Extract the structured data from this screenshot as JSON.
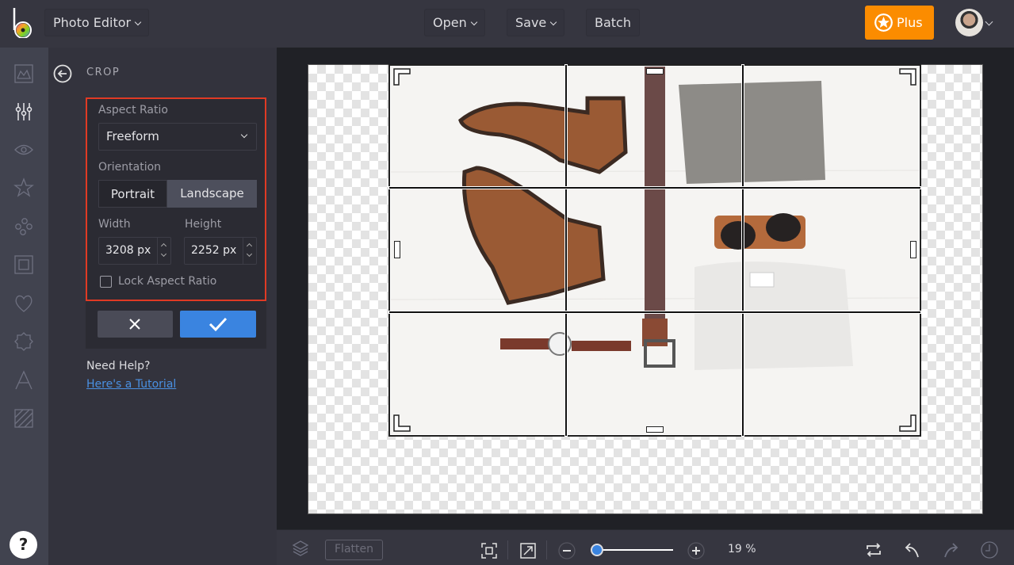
{
  "topbar": {
    "app_menu_label": "Photo Editor",
    "open_label": "Open",
    "save_label": "Save",
    "batch_label": "Batch",
    "plus_label": "Plus",
    "plus_color": "#fb8c00"
  },
  "rail": {
    "items": [
      {
        "name": "image-icon",
        "label": "Image"
      },
      {
        "name": "adjust-sliders-icon",
        "label": "Edit",
        "active": true
      },
      {
        "name": "eye-icon",
        "label": "Effects"
      },
      {
        "name": "star-icon",
        "label": "Touch Up"
      },
      {
        "name": "circles-icon",
        "label": "Artsy"
      },
      {
        "name": "frame-icon",
        "label": "Frames"
      },
      {
        "name": "heart-icon",
        "label": "Graphics"
      },
      {
        "name": "badge-icon",
        "label": "Overlays"
      },
      {
        "name": "text-icon",
        "label": "Text"
      },
      {
        "name": "texture-icon",
        "label": "Textures"
      }
    ],
    "help_label": "?"
  },
  "panel": {
    "title": "CROP",
    "aspect_ratio_label": "Aspect Ratio",
    "aspect_ratio_value": "Freeform",
    "orientation_label": "Orientation",
    "orientation_options": [
      "Portrait",
      "Landscape"
    ],
    "orientation_selected": "Landscape",
    "width_label": "Width",
    "width_value": "3208 px",
    "height_label": "Height",
    "height_value": "2252 px",
    "lock_label": "Lock Aspect Ratio",
    "lock_checked": false,
    "help_title": "Need Help?",
    "help_link": "Here's a Tutorial",
    "highlight_color": "#e03a24",
    "apply_color": "#3a84e0"
  },
  "bottombar": {
    "flatten_label": "Flatten",
    "zoom_value": "19 %",
    "zoom_fraction": 0.0
  }
}
